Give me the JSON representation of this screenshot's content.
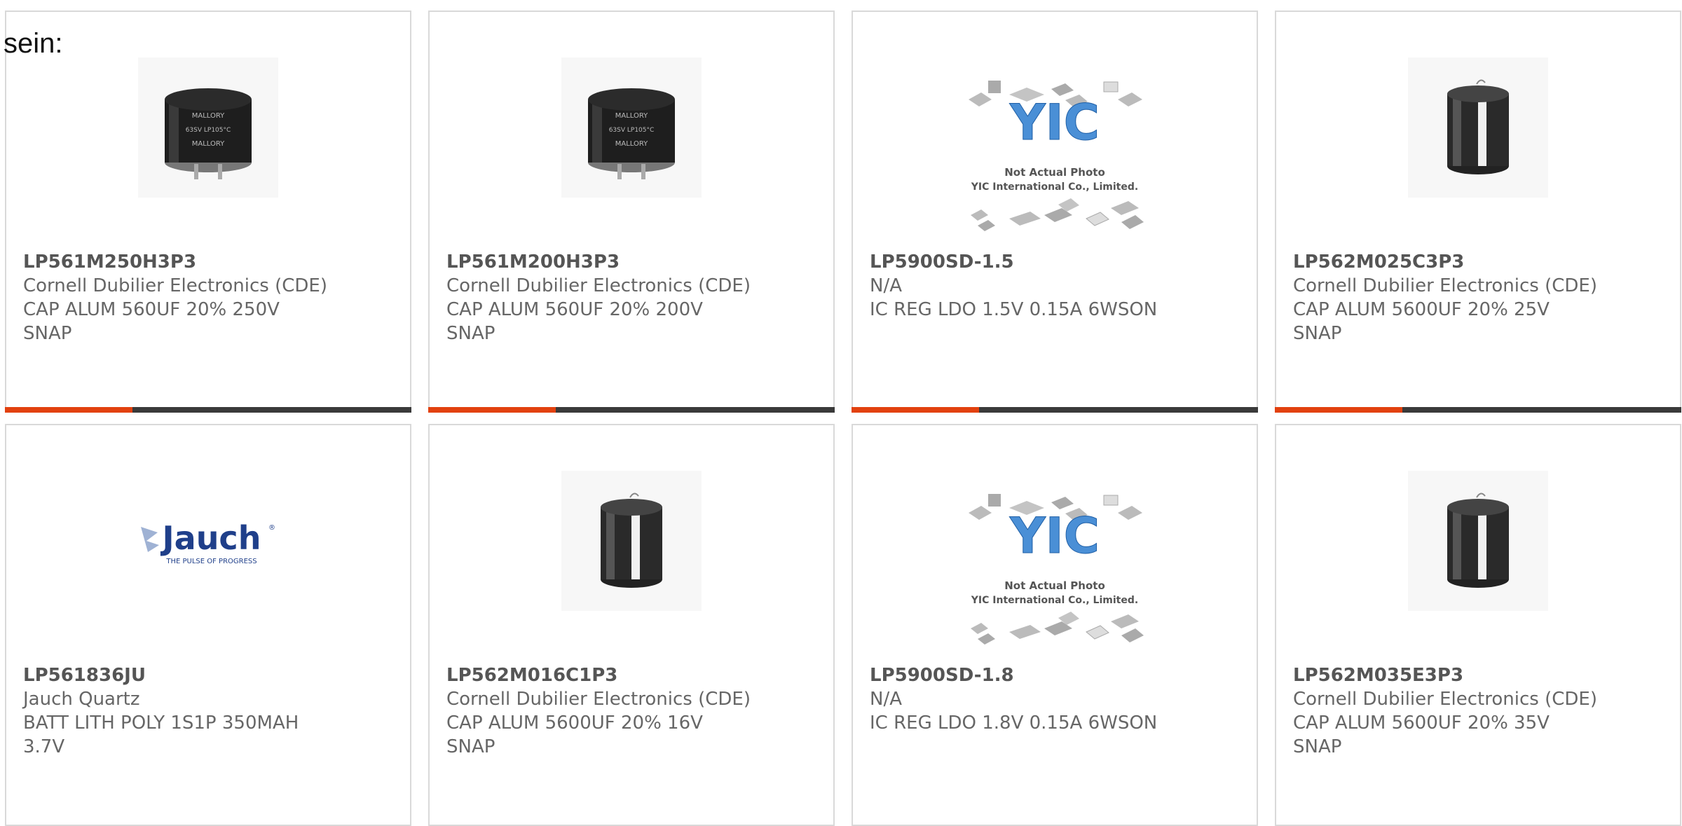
{
  "page_label": "sein:",
  "colors": {
    "accent": "#e2410f",
    "bar": "#3a3a3a",
    "border": "#d9d9d9",
    "text": "#555555"
  },
  "products": [
    {
      "part_number": "LP561M250H3P3",
      "manufacturer": "Cornell Dubilier Electronics (CDE)",
      "description_line1": "CAP ALUM 560UF 20% 250V",
      "description_line2": "SNAP",
      "image": "mallory-capacitor-photo"
    },
    {
      "part_number": "LP561M200H3P3",
      "manufacturer": "Cornell Dubilier Electronics (CDE)",
      "description_line1": "CAP ALUM 560UF 20% 200V",
      "description_line2": "SNAP",
      "image": "mallory-capacitor-photo"
    },
    {
      "part_number": "LP5900SD-1.5",
      "manufacturer": "N/A",
      "description_line1": "IC REG LDO 1.5V 0.15A 6WSON",
      "description_line2": "",
      "image": "yic-placeholder",
      "image_text_1": "Not Actual Photo",
      "image_text_2": "YIC International Co., Limited."
    },
    {
      "part_number": "LP562M025C3P3",
      "manufacturer": "Cornell Dubilier Electronics (CDE)",
      "description_line1": "CAP ALUM 5600UF 20% 25V",
      "description_line2": "SNAP",
      "image": "snap-capacitor-render"
    },
    {
      "part_number": "LP561836JU",
      "manufacturer": "Jauch Quartz",
      "description_line1": "BATT LITH POLY 1S1P 350MAH",
      "description_line2": "3.7V",
      "image": "jauch-logo",
      "logo_tagline": "THE PULSE OF PROGRESS"
    },
    {
      "part_number": "LP562M016C1P3",
      "manufacturer": "Cornell Dubilier Electronics (CDE)",
      "description_line1": "CAP ALUM 5600UF 20% 16V",
      "description_line2": "SNAP",
      "image": "snap-capacitor-render"
    },
    {
      "part_number": "LP5900SD-1.8",
      "manufacturer": "N/A",
      "description_line1": "IC REG LDO 1.8V 0.15A 6WSON",
      "description_line2": "",
      "image": "yic-placeholder",
      "image_text_1": "Not Actual Photo",
      "image_text_2": "YIC International Co., Limited."
    },
    {
      "part_number": "LP562M035E3P3",
      "manufacturer": "Cornell Dubilier Electronics (CDE)",
      "description_line1": "CAP ALUM 5600UF 20% 35V",
      "description_line2": "SNAP",
      "image": "snap-capacitor-render"
    }
  ]
}
